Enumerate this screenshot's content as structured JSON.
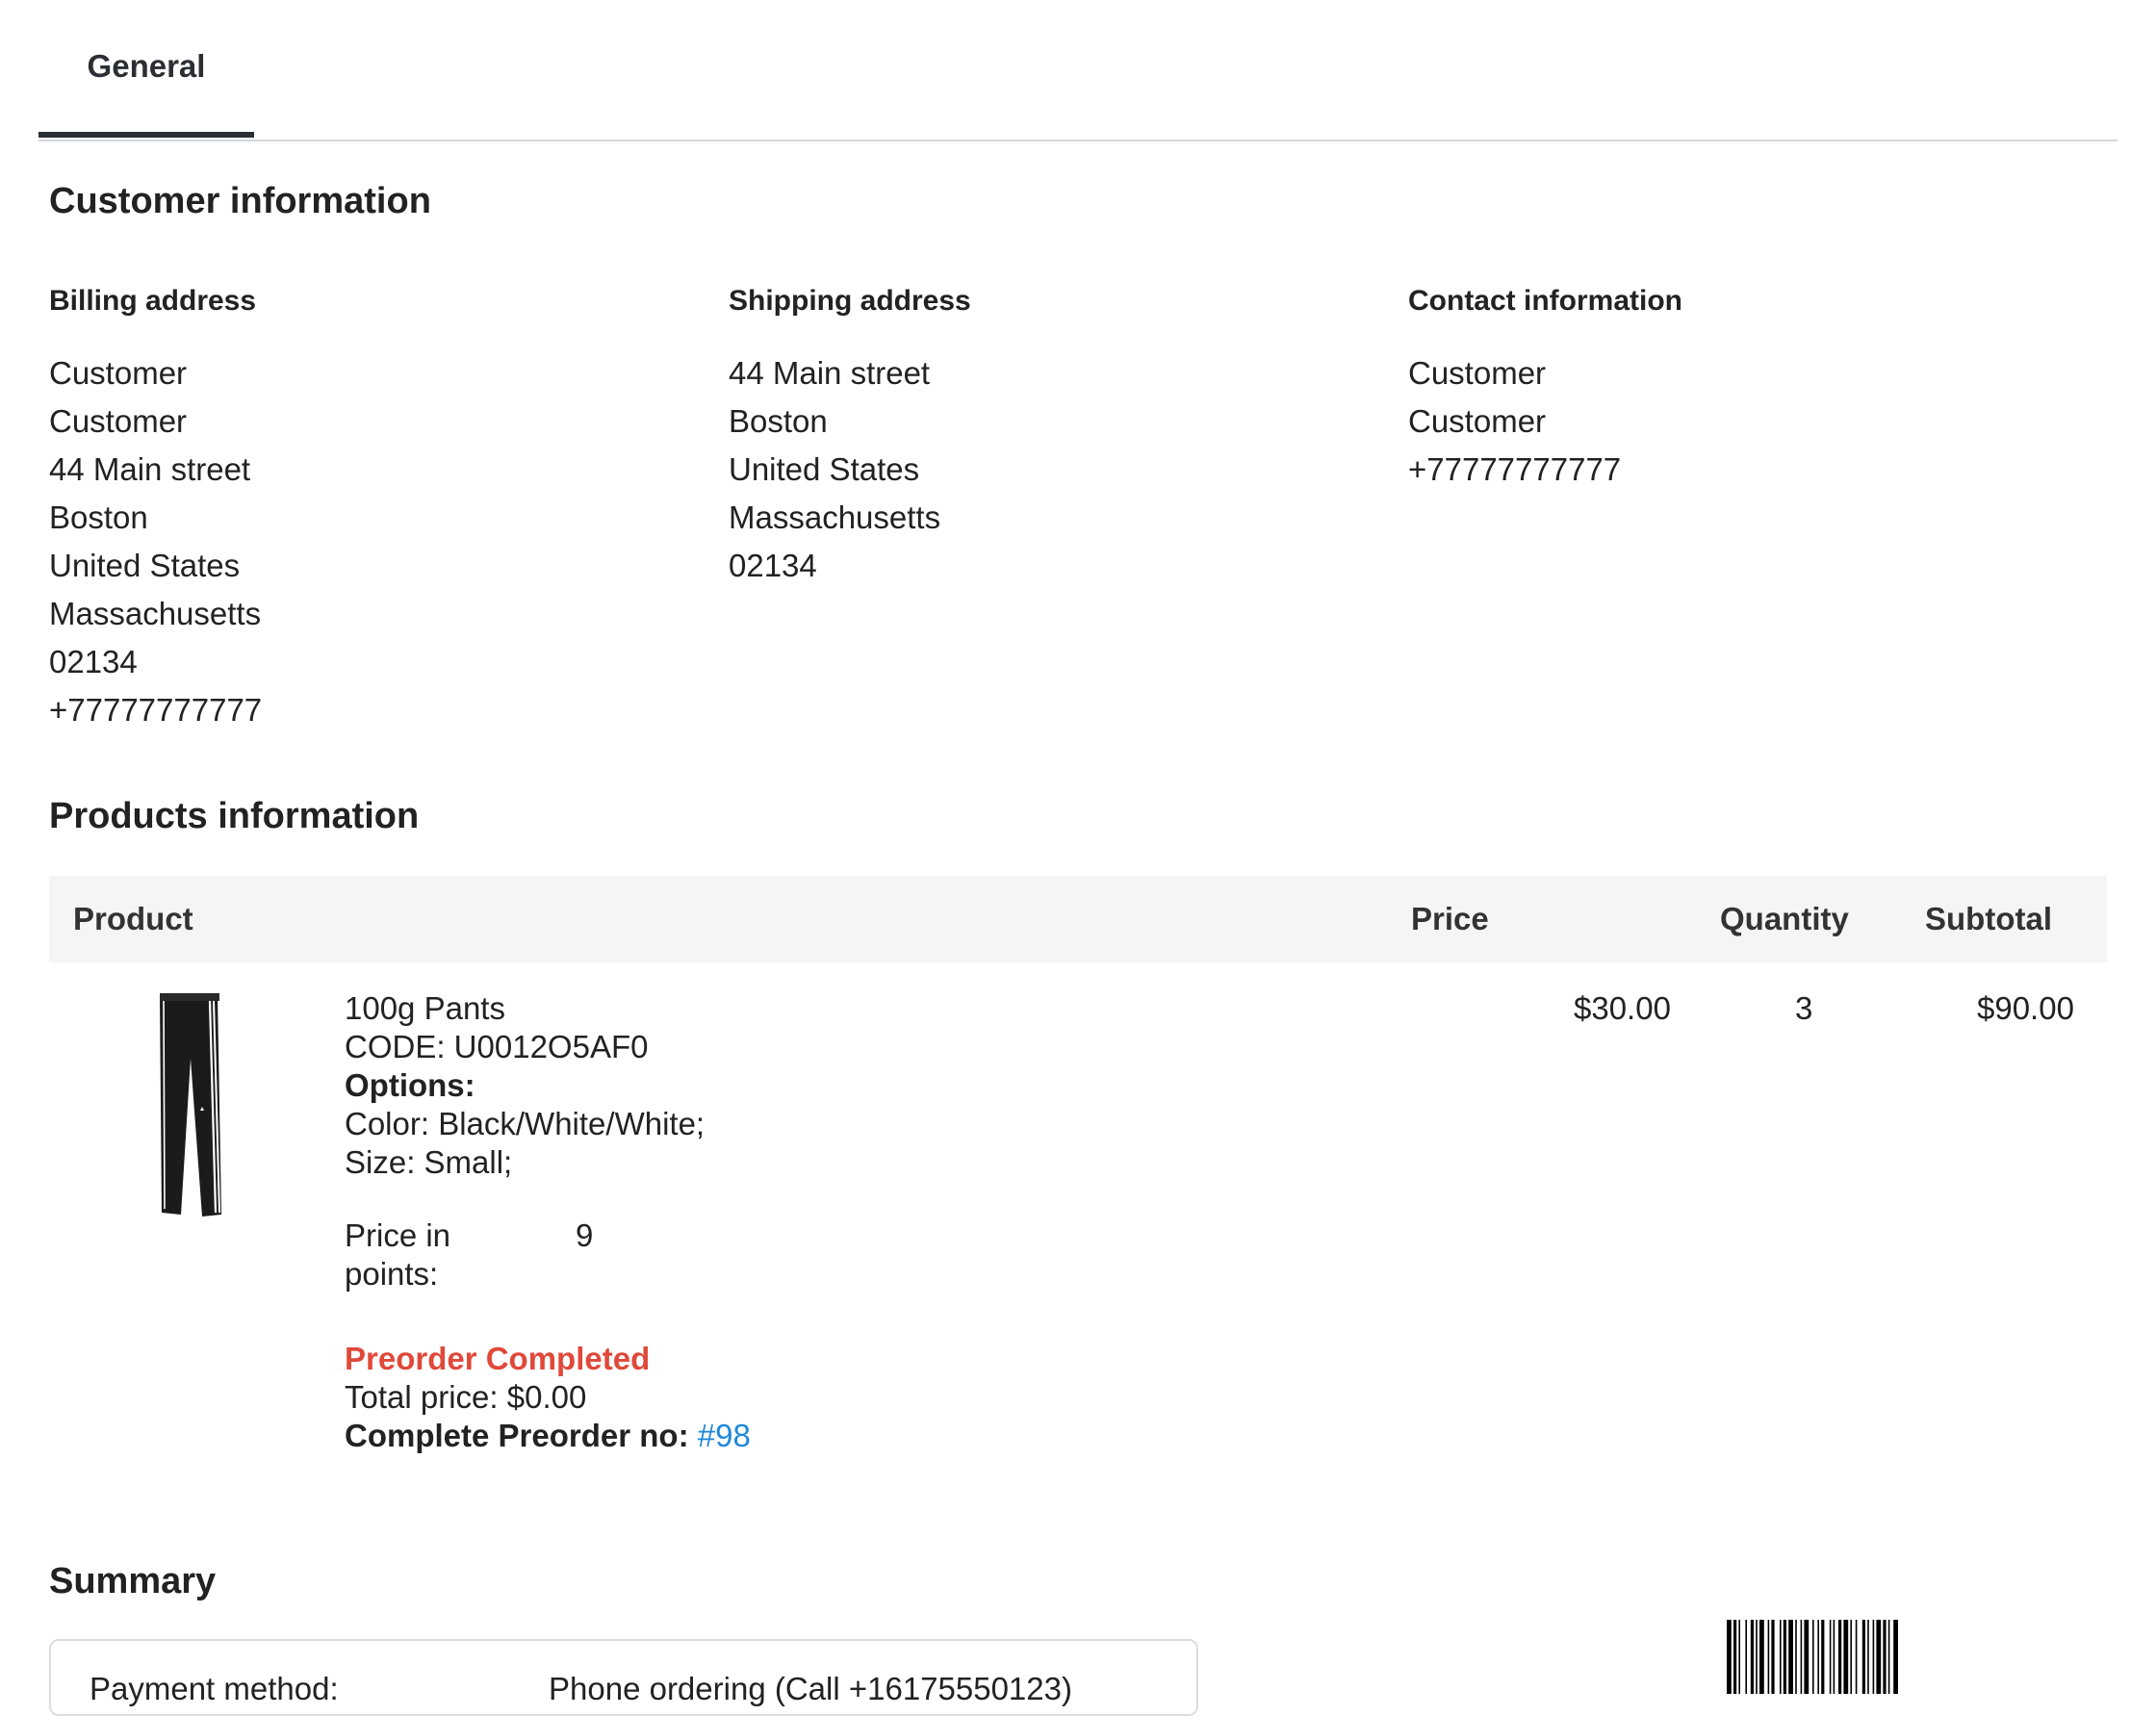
{
  "tabs": [
    {
      "label": "General",
      "active": true
    }
  ],
  "customer": {
    "title": "Customer information",
    "billing": {
      "title": "Billing address",
      "lines": [
        "Customer",
        "Customer",
        "44 Main street",
        "Boston",
        "United States",
        "Massachusetts",
        "02134",
        "+77777777777"
      ]
    },
    "shipping": {
      "title": "Shipping address",
      "lines": [
        "44 Main street",
        "Boston",
        "United States",
        "Massachusetts",
        "02134"
      ]
    },
    "contact": {
      "title": "Contact information",
      "lines": [
        "Customer",
        "Customer",
        "+77777777777"
      ]
    }
  },
  "products": {
    "title": "Products information",
    "headers": {
      "product": "Product",
      "price": "Price",
      "quantity": "Quantity",
      "subtotal": "Subtotal"
    },
    "item": {
      "name": "100g Pants",
      "code": "CODE: U0012O5AF0",
      "options_label": "Options:",
      "options": [
        "Color: Black/White/White;",
        "Size: Small;"
      ],
      "points_label_1": "Price in",
      "points_label_2": "points:",
      "points_value": "9",
      "preorder_status": "Preorder Completed",
      "total_price": "Total price: $0.00",
      "complete_label": "Complete Preorder no:",
      "complete_link": "#98",
      "price": "$30.00",
      "quantity": "3",
      "subtotal": "$90.00"
    }
  },
  "summary": {
    "title": "Summary",
    "payment_label": "Payment method:",
    "payment_value": "Phone ordering (Call +16175550123)"
  },
  "colors": {
    "accent_link": "#1e88d9",
    "preorder_status": "#e0493a",
    "table_header_bg": "#f5f5f5"
  }
}
